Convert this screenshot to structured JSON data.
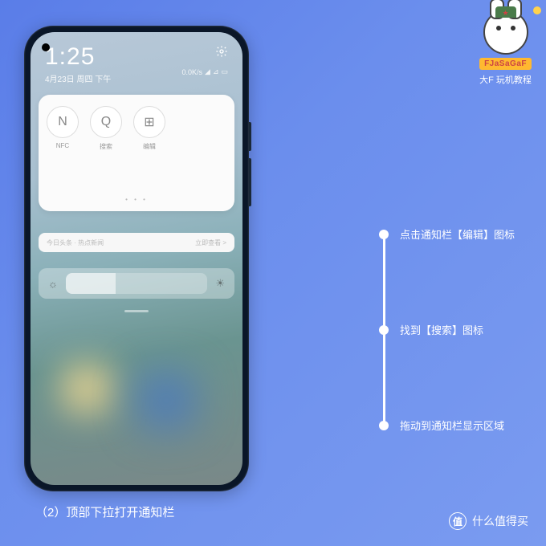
{
  "mascot": {
    "banner": "FJaSaGaF",
    "subtitle": "大F 玩机教程"
  },
  "status_bar": {
    "time": "1:25",
    "date": "4月23日 周四 下午",
    "data": "0.0K/s"
  },
  "quick_tiles": [
    {
      "icon": "N",
      "label": "NFC"
    },
    {
      "icon": "Q",
      "label": "搜索"
    },
    {
      "icon": "⊞",
      "label": "编辑"
    }
  ],
  "banner": {
    "left": "今日头条 · 热点新闻",
    "right": "立即查看 >"
  },
  "caption": "（2）顶部下拉打开通知栏",
  "steps": [
    "点击通知栏【编辑】图标",
    "找到【搜索】图标",
    "拖动到通知栏显示区域"
  ],
  "footer": {
    "logo": "值",
    "text": "什么值得买"
  }
}
